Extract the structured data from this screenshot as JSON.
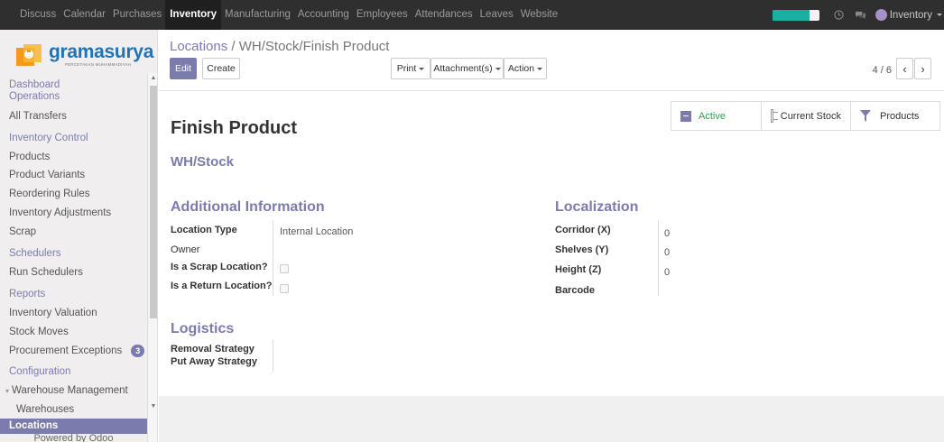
{
  "topbar": {
    "menu": [
      "Discuss",
      "Calendar",
      "Purchases",
      "Inventory",
      "Manufacturing",
      "Accounting",
      "Employees",
      "Attendances",
      "Leaves",
      "Website"
    ],
    "active_index": 3,
    "progress": 0.8,
    "user": "Inventory",
    "icons": [
      "clock-icon",
      "chat-icon"
    ]
  },
  "sidebar": {
    "logo": {
      "brand": "gramasurya",
      "tagline": "PERCETAKAN MUHAMMADIYAH"
    },
    "dashboard": "Dashboard",
    "operations": "Operations",
    "all_transfers": "All Transfers",
    "inventory_control": "Inventory Control",
    "products": "Products",
    "product_variants": "Product Variants",
    "reordering_rules": "Reordering Rules",
    "inventory_adjustments": "Inventory Adjustments",
    "scrap": "Scrap",
    "schedulers": "Schedulers",
    "run_schedulers": "Run Schedulers",
    "reports": "Reports",
    "inventory_valuation": "Inventory Valuation",
    "stock_moves": "Stock Moves",
    "procurement_exceptions": "Procurement Exceptions",
    "procurement_count": "3",
    "configuration": "Configuration",
    "warehouse_management": "Warehouse Management",
    "warehouses": "Warehouses",
    "locations": "Locations",
    "powered": "Powered by Odoo"
  },
  "control": {
    "breadcrumb_parent": "Locations",
    "breadcrumb_sep": " / ",
    "breadcrumb_current": "WH/Stock/Finish Product",
    "edit": "Edit",
    "create": "Create",
    "print": "Print",
    "attachments": "Attachment(s)",
    "action": "Action",
    "pager": "4 / 6"
  },
  "form": {
    "stat_active": "Active",
    "stat_current_stock": "Current Stock",
    "stat_products": "Products",
    "title": "Finish Product",
    "parent": "WH/Stock",
    "additional_info": "Additional Information",
    "location_type_label": "Location Type",
    "location_type_value": "Internal Location",
    "owner_label": "Owner",
    "scrap_label": "Is a Scrap Location?",
    "return_label": "Is a Return Location?",
    "localization": "Localization",
    "corridor_label": "Corridor (X)",
    "corridor_value": "0",
    "shelves_label": "Shelves (Y)",
    "shelves_value": "0",
    "height_label": "Height (Z)",
    "height_value": "0",
    "barcode_label": "Barcode",
    "logistics": "Logistics",
    "removal_label": "Removal Strategy",
    "putaway_label": "Put Away Strategy"
  }
}
